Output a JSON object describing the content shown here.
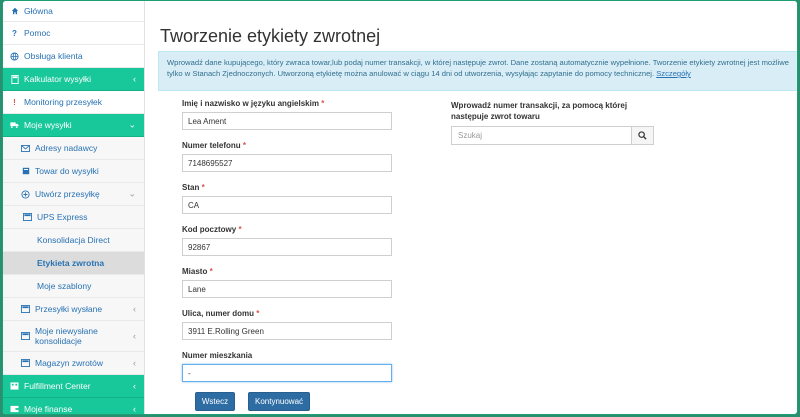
{
  "sidebar": {
    "items": [
      {
        "label": "Główna",
        "icon": "home-icon"
      },
      {
        "label": "Pomoc",
        "icon": "question-icon"
      },
      {
        "label": "Obsługa klienta",
        "icon": "globe-icon"
      },
      {
        "label": "Kalkulator wysyłki",
        "icon": "calculator-icon"
      },
      {
        "label": "Monitoring przesyłek",
        "icon": "exclamation-icon"
      },
      {
        "label": "Moje wysyłki",
        "icon": "truck-icon"
      },
      {
        "label": "Adresy nadawcy",
        "icon": "envelope-icon"
      },
      {
        "label": "Towar do wysyłki",
        "icon": "box-icon"
      },
      {
        "label": "Utwórz przesyłkę",
        "icon": "plus-circle-icon"
      },
      {
        "label": "UPS Express",
        "icon": "list-icon"
      },
      {
        "label": "Konsolidacja Direct"
      },
      {
        "label": "Etykieta zwrotna"
      },
      {
        "label": "Moje szablony"
      },
      {
        "label": "Przesyłki wysłane",
        "icon": "list-icon"
      },
      {
        "label": "Moje niewysłane konsolidacje",
        "icon": "list-icon"
      },
      {
        "label": "Magazyn zwrotów",
        "icon": "list-icon"
      },
      {
        "label": "Fulfillment Center",
        "icon": "building-icon"
      },
      {
        "label": "Moje finanse",
        "icon": "wallet-icon"
      }
    ]
  },
  "main": {
    "title": "Tworzenie etykiety zwrotnej",
    "info_text": "Wprowadź dane kupującego, który zwraca towar,lub podaj numer transakcji, w której następuje zwrot. Dane zostaną automatycznie wypełnione. Tworzenie etykiety zwrotnej jest możliwe tylko w Stanach Zjednoczonych. Utworzoną etykietę można anulować w ciągu 14 dni od utworzenia, wysyłając zapytanie do pomocy technicznej.",
    "info_link": "Szczegóły"
  },
  "form": {
    "name_label": "Imię i nazwisko w języku angielskim",
    "name_value": "Lea Ament",
    "phone_label": "Numer telefonu",
    "phone_value": "7148695527",
    "state_label": "Stan",
    "state_value": "CA",
    "zip_label": "Kod pocztowy",
    "zip_value": "92867",
    "city_label": "Miasto",
    "city_value": "Lane",
    "street_label": "Ulica, numer domu",
    "street_value": "3911 E.Rolling Green",
    "apt_label": "Numer mieszkania",
    "apt_value": "-",
    "required_mark": "*"
  },
  "transaction": {
    "label": "Wprowadź numer transakcji, za pomocą której następuje zwrot towaru",
    "placeholder": "Szukaj"
  },
  "buttons": {
    "back": "Wstecz",
    "continue": "Kontynuować"
  }
}
